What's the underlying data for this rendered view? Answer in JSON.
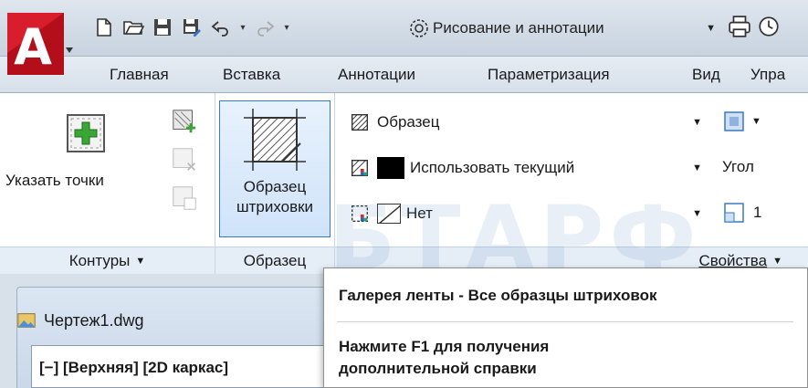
{
  "app": {
    "logo_letter": "A",
    "accent": "#c1121f"
  },
  "quick_access": {
    "icons": [
      "new-file-icon",
      "open-folder-icon",
      "save-icon",
      "save-as-icon",
      "undo-icon",
      "redo-icon"
    ],
    "workspace_label": "Рисование и аннотации",
    "right_icons": [
      "print-icon",
      "clock-icon"
    ]
  },
  "tabs": [
    "Главная",
    "Вставка",
    "Аннотации",
    "Параметризация",
    "Вид",
    "Упра"
  ],
  "ribbon": {
    "contours_panel": {
      "add_points_label": "Указать точки",
      "footer": "Контуры"
    },
    "pattern_panel": {
      "button_line1": "Образец",
      "button_line2": "штриховки",
      "footer": "Образец"
    },
    "properties_panel": {
      "pattern_value": "Образец",
      "color_value": "Использовать текущий",
      "background_value": "Нет",
      "angle_label": "Угол",
      "scale_value": "1",
      "footer": "Свойства"
    }
  },
  "document": {
    "tab_title": "Чертеж1.dwg",
    "viewport_label": "[−] [Верхняя] [2D каркас]"
  },
  "tooltip": {
    "title": "Галерея ленты - Все образцы штриховок",
    "help_line1": "Нажмите F1 для получения",
    "help_line2": "дополнительной справки"
  },
  "watermark": "БТАРФ"
}
